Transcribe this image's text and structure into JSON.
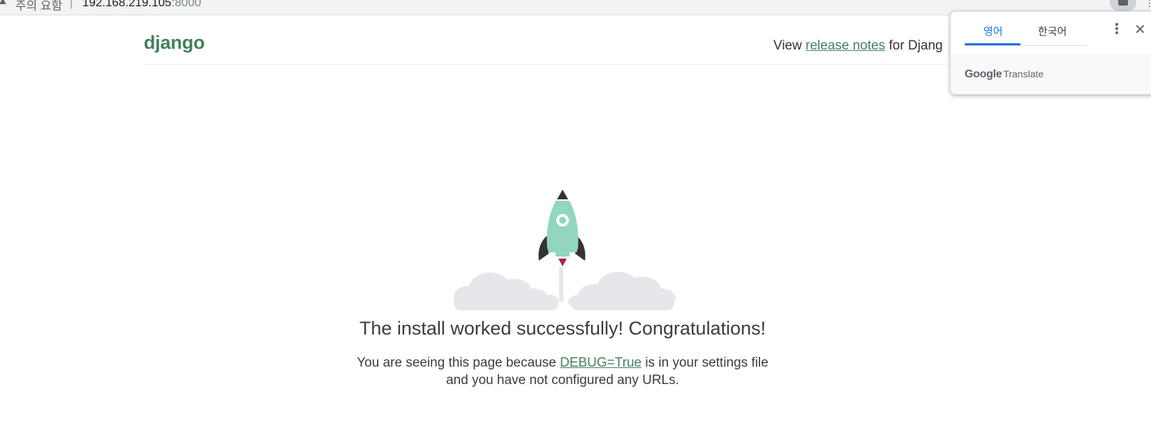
{
  "browser": {
    "security_label": "주의 요함",
    "separator": "|",
    "url_host": "192.168.219.105",
    "url_port": ":8000"
  },
  "header": {
    "logo": "django",
    "release_prefix": "View ",
    "release_link": "release notes",
    "release_suffix": " for Djang"
  },
  "main": {
    "title": "The install worked successfully! Congratulations!",
    "desc_prefix": "You are seeing this page because ",
    "desc_link": "DEBUG=True",
    "desc_suffix": " is in your settings file and you have not configured any URLs."
  },
  "translate_popup": {
    "tabs": [
      {
        "label": "영어",
        "active": true
      },
      {
        "label": "한국어",
        "active": false
      }
    ],
    "brand_google": "Google",
    "brand_translate": "Translate",
    "close_glyph": "✕"
  },
  "colors": {
    "django_green": "#44805a",
    "link_green": "#448060",
    "rocket_body": "#92d6bf",
    "rocket_fins": "#333333",
    "flame": "#a8234a",
    "cloud": "#e6e7ea",
    "translate_blue": "#1a73e8"
  },
  "icons": {
    "address_bar": [
      "security-warning-icon",
      "translate-icon"
    ],
    "popup": [
      "more-vert-icon",
      "close-icon"
    ]
  }
}
